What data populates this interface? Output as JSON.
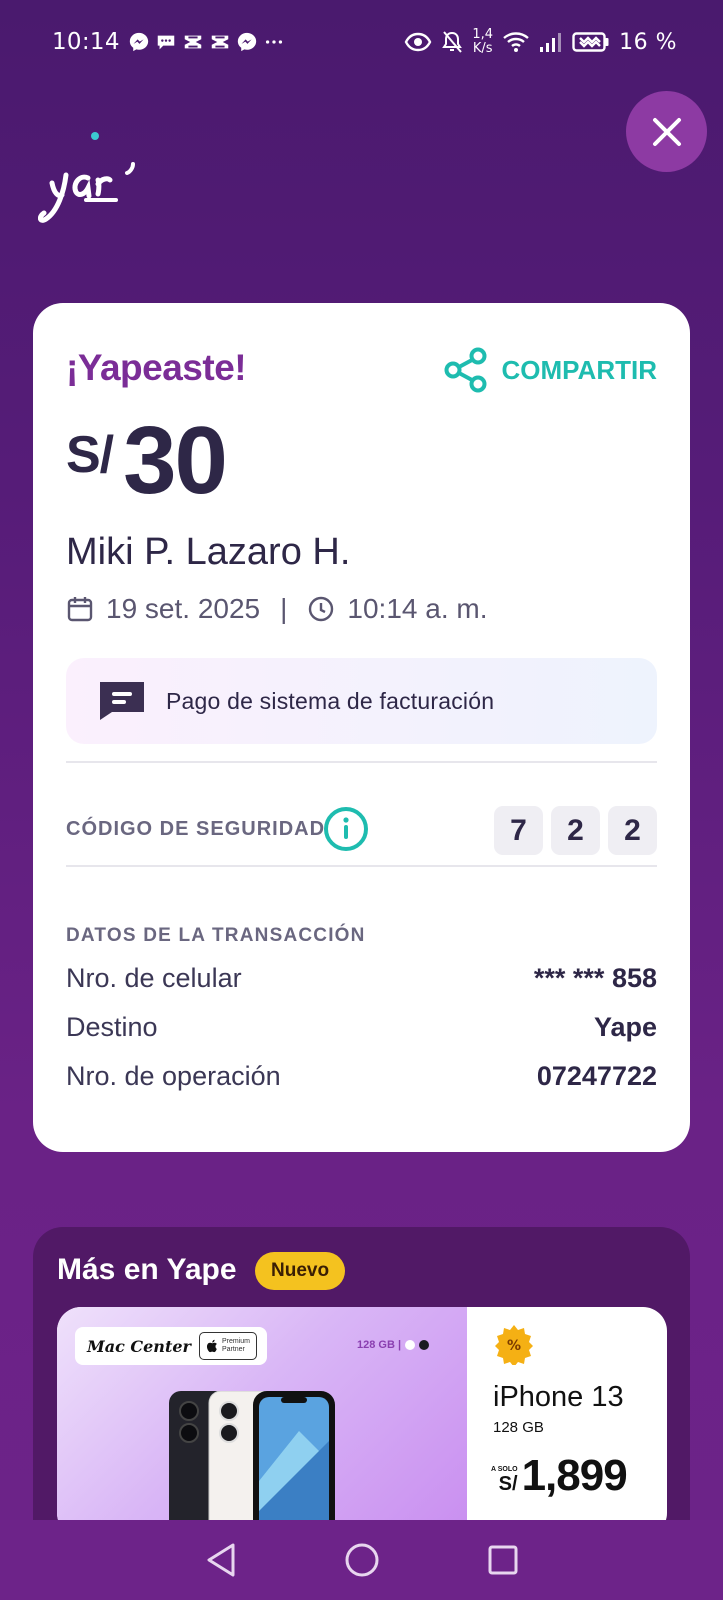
{
  "status_bar": {
    "time": "10:14",
    "net_speed_value": "1,4",
    "net_speed_unit": "K/s",
    "battery": "16 %"
  },
  "header": {
    "logo_text": "yap",
    "close_label": "Cerrar"
  },
  "receipt": {
    "title": "¡Yapeaste!",
    "share_label": "COMPARTIR",
    "currency": "S/",
    "amount": "30",
    "recipient": "Miki P. Lazaro H.",
    "date": "19 set. 2025",
    "separator": "|",
    "time": "10:14 a. m.",
    "memo": "Pago de sistema de facturación",
    "security_label": "CÓDIGO DE SEGURIDAD",
    "security_code": [
      "7",
      "2",
      "2"
    ],
    "tx_heading": "DATOS DE LA TRANSACCIÓN",
    "tx_rows": [
      {
        "label": "Nro. de celular",
        "value": "*** *** 858"
      },
      {
        "label": "Destino",
        "value": "Yape"
      },
      {
        "label": "Nro. de operación",
        "value": "07247722"
      }
    ]
  },
  "more": {
    "title": "Más en Yape",
    "badge": "Nuevo",
    "promo": {
      "store": "Mac Center",
      "partner_line1": "Premium",
      "partner_line2": "Partner",
      "storage_tag": "128 GB |",
      "model": "iPhone 13",
      "capacity": "128 GB",
      "price_prefix": "A SOLO",
      "price_currency": "S/",
      "price": "1,899"
    }
  },
  "colors": {
    "accent_purple": "#7b2d97",
    "accent_teal": "#1ebcaf",
    "badge_yellow": "#f4c21f"
  }
}
